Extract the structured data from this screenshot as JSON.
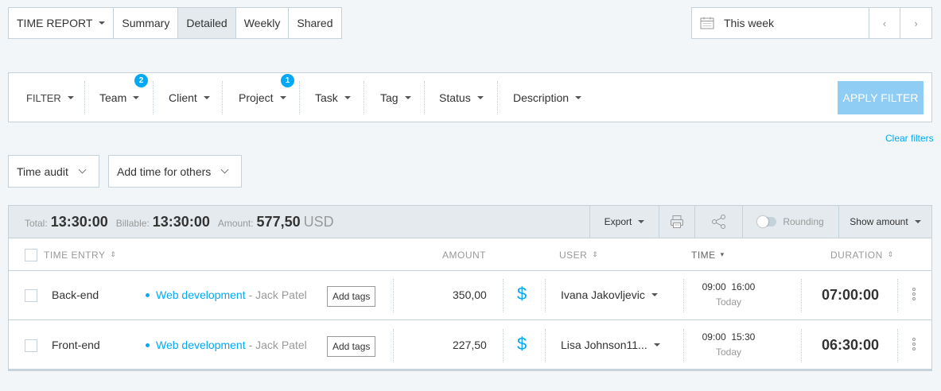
{
  "report_tabs": {
    "time_report": "TIME REPORT",
    "summary": "Summary",
    "detailed": "Detailed",
    "weekly": "Weekly",
    "shared": "Shared"
  },
  "date_range": {
    "label": "This week",
    "prev": "‹",
    "next": "›"
  },
  "filters": {
    "filter": "FILTER",
    "team": "Team",
    "team_badge": "2",
    "client": "Client",
    "project": "Project",
    "project_badge": "1",
    "task": "Task",
    "tag": "Tag",
    "status": "Status",
    "description": "Description",
    "apply": "APPLY FILTER",
    "clear": "Clear filters"
  },
  "actions": {
    "time_audit": "Time audit",
    "add_time_for_others": "Add time for others"
  },
  "summary": {
    "total_label": "Total:",
    "total_value": "13:30:00",
    "billable_label": "Billable:",
    "billable_value": "13:30:00",
    "amount_label": "Amount:",
    "amount_value": "577,50",
    "amount_currency": "USD",
    "export": "Export",
    "rounding": "Rounding",
    "rounding_on": false,
    "show_amount": "Show amount"
  },
  "table": {
    "headers": {
      "time_entry": "TIME ENTRY",
      "amount": "AMOUNT",
      "user": "USER",
      "time": "TIME",
      "duration": "DURATION"
    },
    "add_tags_label": "Add tags",
    "billable_symbol": "$",
    "rows": [
      {
        "description": "Back-end",
        "project": "Web development",
        "client": "- Jack Patel",
        "amount": "350,00",
        "user": "Ivana Jakovljevic",
        "start": "09:00",
        "end": "16:00",
        "day": "Today",
        "duration": "07:00:00"
      },
      {
        "description": "Front-end",
        "project": "Web development",
        "client": "- Jack Patel",
        "amount": "227,50",
        "user": "Lisa Johnson11...",
        "start": "09:00",
        "end": "15:30",
        "day": "Today",
        "duration": "06:30:00"
      }
    ]
  },
  "colors": {
    "accent": "#03a9f4",
    "apply_button": "#90cdf4",
    "background": "#f2f6f8",
    "border": "#c6d2d9",
    "summary_bg": "#e4eaee"
  }
}
